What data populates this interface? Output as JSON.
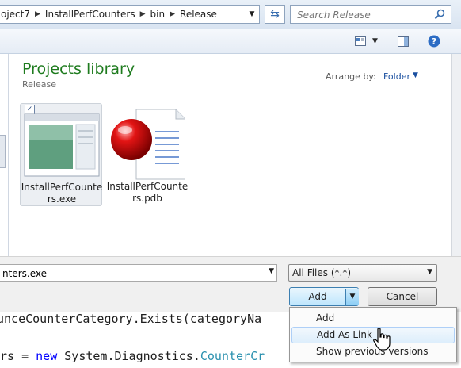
{
  "address_bar": {
    "crumbs": [
      "oject7",
      "InstallPerfCounters",
      "bin",
      "Release"
    ]
  },
  "search": {
    "placeholder": "Search Release"
  },
  "library": {
    "title": "Projects library",
    "subtitle": "Release",
    "arrange_label": "Arrange by:",
    "arrange_value": "Folder"
  },
  "files": [
    {
      "name": "InstallPerfCounters.exe",
      "label_line1": "InstallPerfCounte",
      "label_line2": "rs.exe",
      "selected": true
    },
    {
      "name": "InstallPerfCounters.pdb",
      "label_line1": "InstallPerfCounte",
      "label_line2": "rs.pdb",
      "selected": false
    }
  ],
  "file_name_field": {
    "value": "nters.exe"
  },
  "file_type_filter": {
    "value": "All Files (*.*)"
  },
  "buttons": {
    "add": "Add",
    "cancel": "Cancel"
  },
  "add_menu": {
    "items": [
      "Add",
      "Add As Link",
      "Show previous versions"
    ],
    "highlighted": "Add As Link"
  },
  "code": {
    "line1": "unceCounterCategory.Exists(categoryNa",
    "line2_prefix": "rs = ",
    "line2_keyword": "new",
    "line2_mid": " System.Diagnostics.",
    "line2_type": "CounterCr"
  },
  "colors": {
    "library_title": "#1e7b1e",
    "link_blue": "#1a4fa0",
    "code_keyword": "#0000ff",
    "code_type": "#2b91af"
  }
}
